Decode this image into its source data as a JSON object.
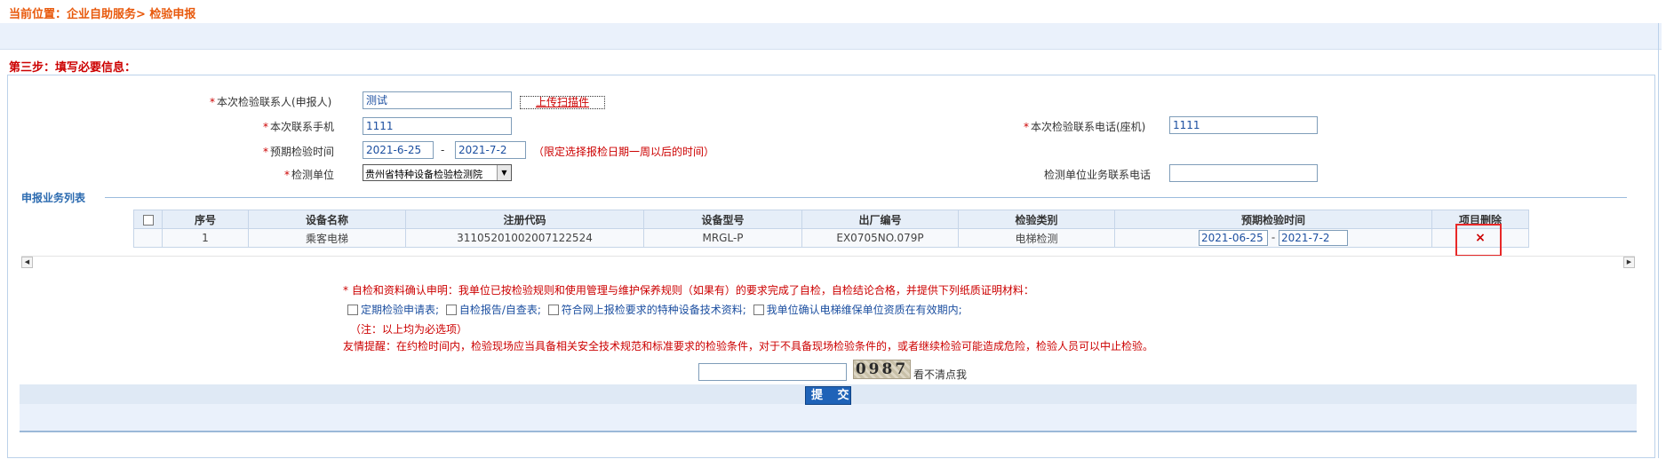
{
  "breadcrumb": {
    "prefix": "当前位置：",
    "path": "企业自助服务> 检验申报"
  },
  "step_title": "第三步：填写必要信息：",
  "form": {
    "contact_label": "本次检验联系人(申报人)",
    "contact_value": "测试",
    "upload_label": "上传扫描件",
    "mobile_label": "本次联系手机",
    "mobile_value": "1111",
    "landline_label": "本次检验联系电话(座机)",
    "landline_value": "1111",
    "date_label": "预期检验时间",
    "date_from": "2021-6-25",
    "date_sep": "-",
    "date_to": "2021-7-2",
    "date_hint": "（限定选择报检日期一周以后的时间）",
    "unit_label": "检测单位",
    "unit_value": "贵州省特种设备检验检测院",
    "unit_phone_label": "检测单位业务联系电话",
    "unit_phone_value": "",
    "required_mark": "*"
  },
  "business_list": {
    "title": "申报业务列表",
    "headers": [
      "序号",
      "设备名称",
      "注册代码",
      "设备型号",
      "出厂编号",
      "检验类别",
      "预期检验时间",
      "项目删除"
    ],
    "rows": [
      {
        "seq": "1",
        "device_name": "乘客电梯",
        "reg_code": "31105201002007122524",
        "model": "MRGL-P",
        "factory_no": "EX0705NO.079P",
        "inspect_type": "电梯检测",
        "date_from": "2021-06-25",
        "date_sep": "-",
        "date_to": "2021-7-2",
        "delete_icon": "×"
      }
    ]
  },
  "declaration": {
    "text": "* 自检和资料确认申明：我单位已按检验规则和使用管理与维护保养规则（如果有）的要求完成了自检，自检结论合格，并提供下列纸质证明材料：",
    "options": [
      "定期检验申请表;",
      "自检报告/自查表;",
      "符合网上报检要求的特种设备技术资料;",
      "我单位确认电梯维保单位资质在有效期内;"
    ],
    "note": "（注：以上均为必选项）",
    "reminder": "友情提醒：在约检时间内，检验现场应当具备相关安全技术规范和标准要求的检验条件，对于不具备现场检验条件的，或者继续检验可能造成危险，检验人员可以中止检验。"
  },
  "captcha": {
    "input_value": "",
    "code": "0987",
    "refresh_label": "看不清点我"
  },
  "submit_label": "提 交"
}
